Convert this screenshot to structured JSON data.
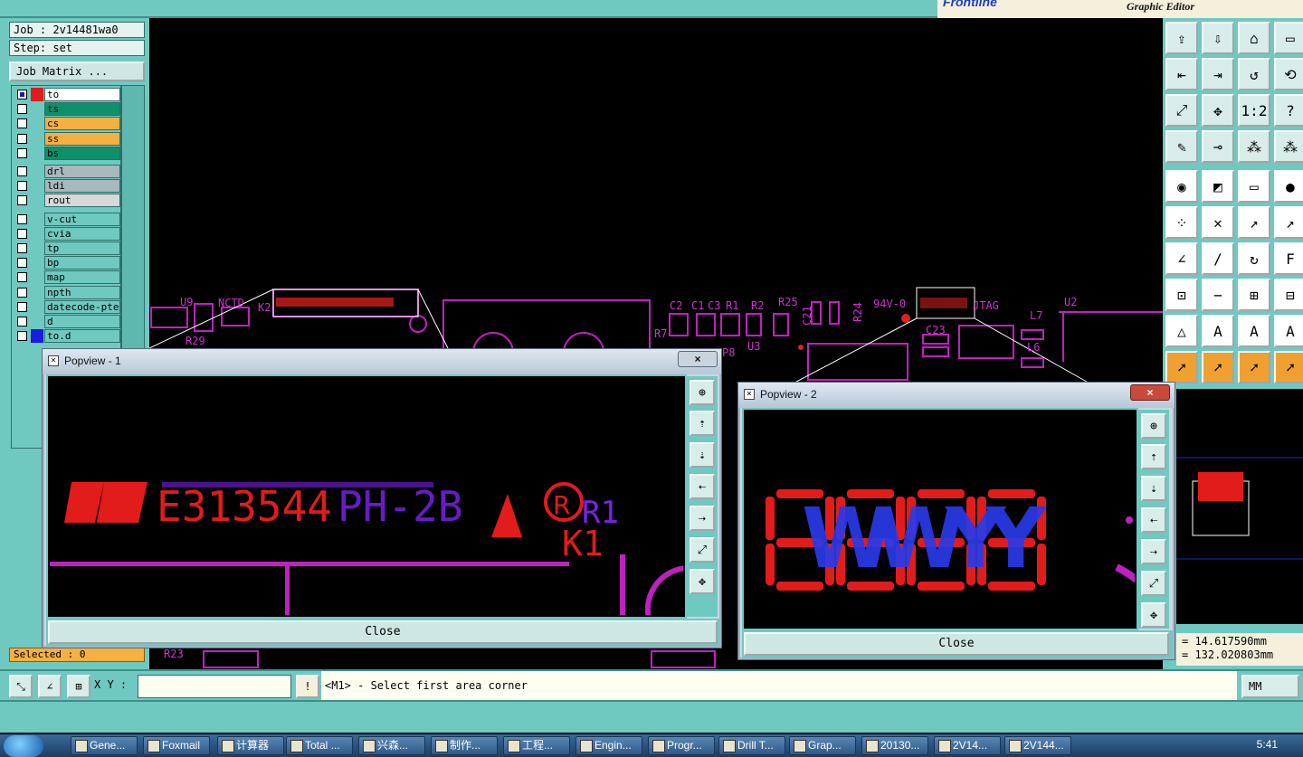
{
  "app": {
    "brand": "Frontline",
    "subtitle": "Graphic Editor"
  },
  "job": {
    "job": "Job : 2v14481wa0",
    "step": "Step: set",
    "matrix_button": "Job Matrix ..."
  },
  "layers": [
    {
      "name": "to",
      "color": "#ffffff",
      "checked": true,
      "swatch": "#e21b1b"
    },
    {
      "name": "ts",
      "color": "#0f8f6a",
      "checked": false,
      "swatch": ""
    },
    {
      "name": "cs",
      "color": "#f4b040",
      "checked": false,
      "swatch": ""
    },
    {
      "name": "ss",
      "color": "#f4b040",
      "checked": false,
      "swatch": ""
    },
    {
      "name": "bs",
      "color": "#0f8f6a",
      "checked": false,
      "swatch": ""
    },
    {
      "name": "drl",
      "color": "#a9b8bc",
      "checked": false,
      "swatch": ""
    },
    {
      "name": "ldi",
      "color": "#a9b8bc",
      "checked": false,
      "swatch": ""
    },
    {
      "name": "rout",
      "color": "#d8d8d8",
      "checked": false,
      "swatch": ""
    },
    {
      "name": "v-cut",
      "color": "#6fc9c0",
      "checked": false,
      "swatch": ""
    },
    {
      "name": "cvia",
      "color": "#6fc9c0",
      "checked": false,
      "swatch": ""
    },
    {
      "name": "tp",
      "color": "#6fc9c0",
      "checked": false,
      "swatch": ""
    },
    {
      "name": "bp",
      "color": "#6fc9c0",
      "checked": false,
      "swatch": ""
    },
    {
      "name": "map",
      "color": "#6fc9c0",
      "checked": false,
      "swatch": ""
    },
    {
      "name": "npth",
      "color": "#6fc9c0",
      "checked": false,
      "swatch": ""
    },
    {
      "name": "datecode-pte",
      "color": "#6fc9c0",
      "checked": false,
      "swatch": ""
    },
    {
      "name": "d",
      "color": "#6fc9c0",
      "checked": false,
      "swatch": ""
    },
    {
      "name": "to.d",
      "color": "#6fc9c0",
      "checked": false,
      "swatch": "#1a1ae0"
    }
  ],
  "selected": "Selected : 0",
  "canvas_labels": [
    "U9",
    "NCTD",
    "K2",
    "R29",
    "C2",
    "C1",
    "C3",
    "R1",
    "R2",
    "R25",
    "R7",
    "P8",
    "U3",
    "94V-0",
    "JTAG",
    "L7",
    "U2",
    "C23",
    "L6",
    "R24",
    "C21",
    "R23"
  ],
  "popview1": {
    "title": "Popview - 1",
    "close": "Close",
    "x_label": "×",
    "marking": "E313544 PH-2B",
    "ref": "R1",
    "ref2": "K1"
  },
  "popview2": {
    "title": "Popview - 2",
    "close": "Close",
    "x_label": "×",
    "marking": "WWYY"
  },
  "coords": {
    "x": "= 14.617590mm",
    "y": "= 132.020803mm"
  },
  "status": {
    "xy_label": "X Y :",
    "xy_value": "",
    "message": "<M1> - Select first area corner",
    "unit": "MM"
  },
  "taskbar": {
    "items": [
      "Gene...",
      "Foxmail",
      "计算器",
      "Total ...",
      "兴森...",
      "制作...",
      "工程...",
      "Engin...",
      "Progr...",
      "Drill T...",
      "Grap...",
      "20130...",
      "2V14...",
      "2V144..."
    ],
    "clock": "5:41"
  }
}
